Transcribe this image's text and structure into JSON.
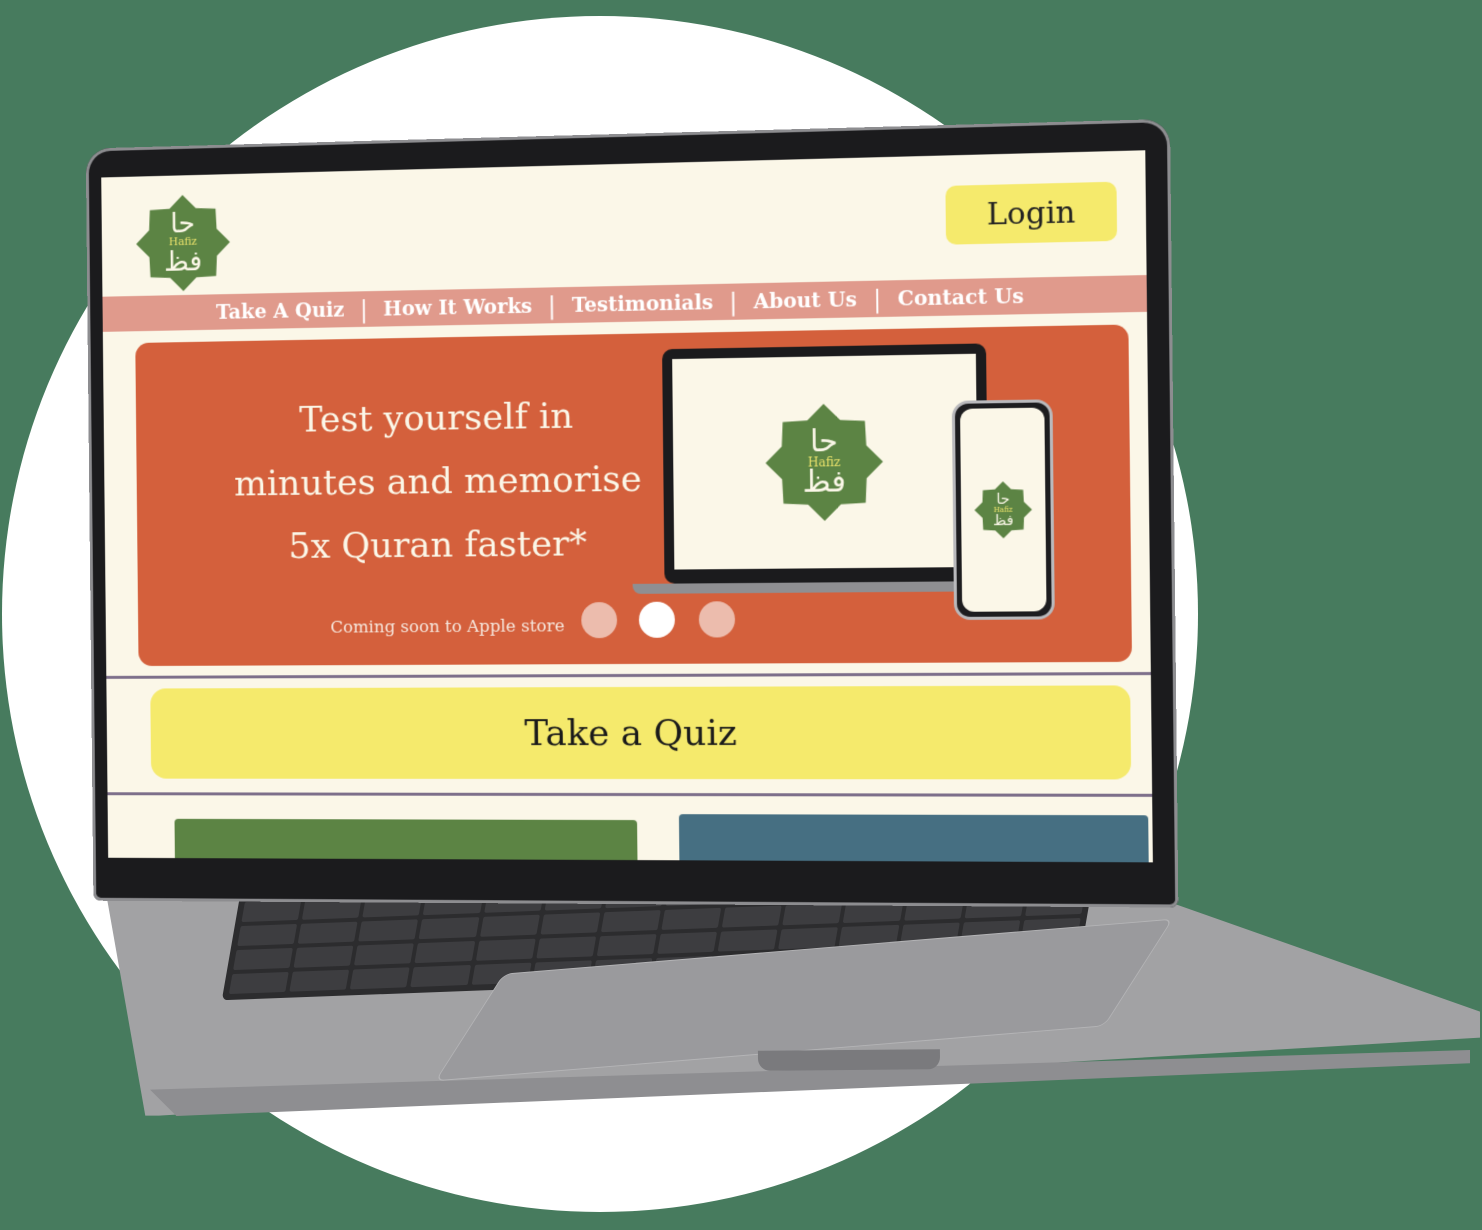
{
  "logo": {
    "arabic_top": "حا",
    "arabic_bottom": "فظ",
    "latin": "Hafiz"
  },
  "header": {
    "login_label": "Login"
  },
  "nav": {
    "items": [
      "Take A Quiz",
      "How It Works",
      "Testimonials",
      "About Us",
      "Contact Us"
    ],
    "separator": "|"
  },
  "hero": {
    "headline_line1": "Test yourself in",
    "headline_line2": "minutes and memorise",
    "headline_line3": "5x Quran faster*",
    "coming_soon": "Coming soon to Apple store",
    "carousel_dots": 3,
    "carousel_active_index": 1
  },
  "quiz_section": {
    "label": "Take a Quiz"
  },
  "colors": {
    "background": "#477b5e",
    "accent_yellow": "#f5ea6c",
    "hero_orange": "#d4603c",
    "nav_pink": "#e09a8c",
    "logo_green": "#5c8444",
    "card_blue": "#466f82"
  }
}
